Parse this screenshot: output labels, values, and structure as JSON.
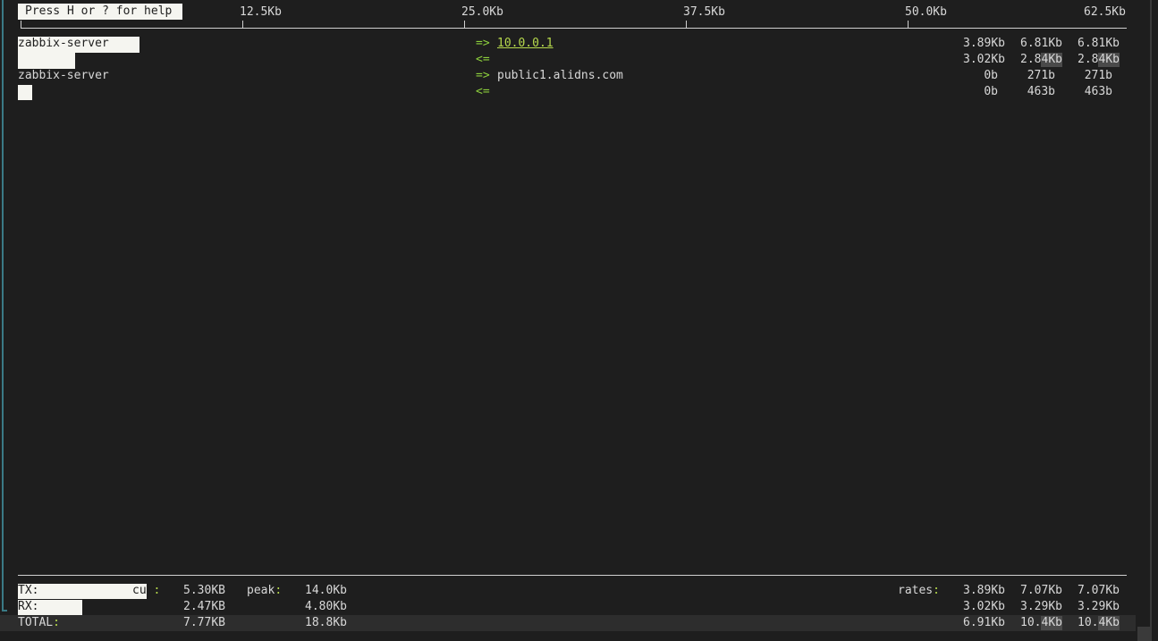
{
  "help": {
    "text": "Press H or ? for help"
  },
  "scale": {
    "labels": [
      "12.5Kb",
      "25.0Kb",
      "37.5Kb",
      "50.0Kb",
      "62.5Kb"
    ]
  },
  "connections": [
    {
      "host": "zabbix-server",
      "arrow_out": "=>",
      "arrow_in": "<=",
      "remote": "10.0.0.1",
      "tx": [
        "3.89Kb",
        "6.81Kb",
        "6.81Kb"
      ],
      "rx": [
        "3.02Kb",
        "2.84Kb",
        "2.84Kb"
      ]
    },
    {
      "host": "zabbix-server",
      "arrow_out": "=>",
      "arrow_in": "<=",
      "remote": "public1.alidns.com",
      "tx": [
        "0b",
        "271b",
        "271b"
      ],
      "rx": [
        "0b",
        "463b",
        "463b"
      ]
    }
  ],
  "summary": {
    "tx_label": "TX:",
    "rx_label": "RX:",
    "total_label": "TOTAL:",
    "cum_label": "cum:",
    "peak_label": "peak:",
    "rates_label": "rates:",
    "tx_cum": "5.30KB",
    "rx_cum": "2.47KB",
    "total_cum": "7.77KB",
    "tx_peak": "14.0Kb",
    "rx_peak": "4.80Kb",
    "total_peak": "18.8Kb",
    "tx_rates": [
      "3.89Kb",
      "7.07Kb",
      "7.07Kb"
    ],
    "rx_rates": [
      "3.02Kb",
      "3.29Kb",
      "3.29Kb"
    ],
    "total_rates": [
      "6.91Kb",
      "10.4Kb",
      "10.4Kb"
    ]
  },
  "colors": {
    "background": "#1e1e1e",
    "foreground": "#d8d8d8",
    "accent_green": "#8ccf3c",
    "frame": "#3a7a85"
  }
}
